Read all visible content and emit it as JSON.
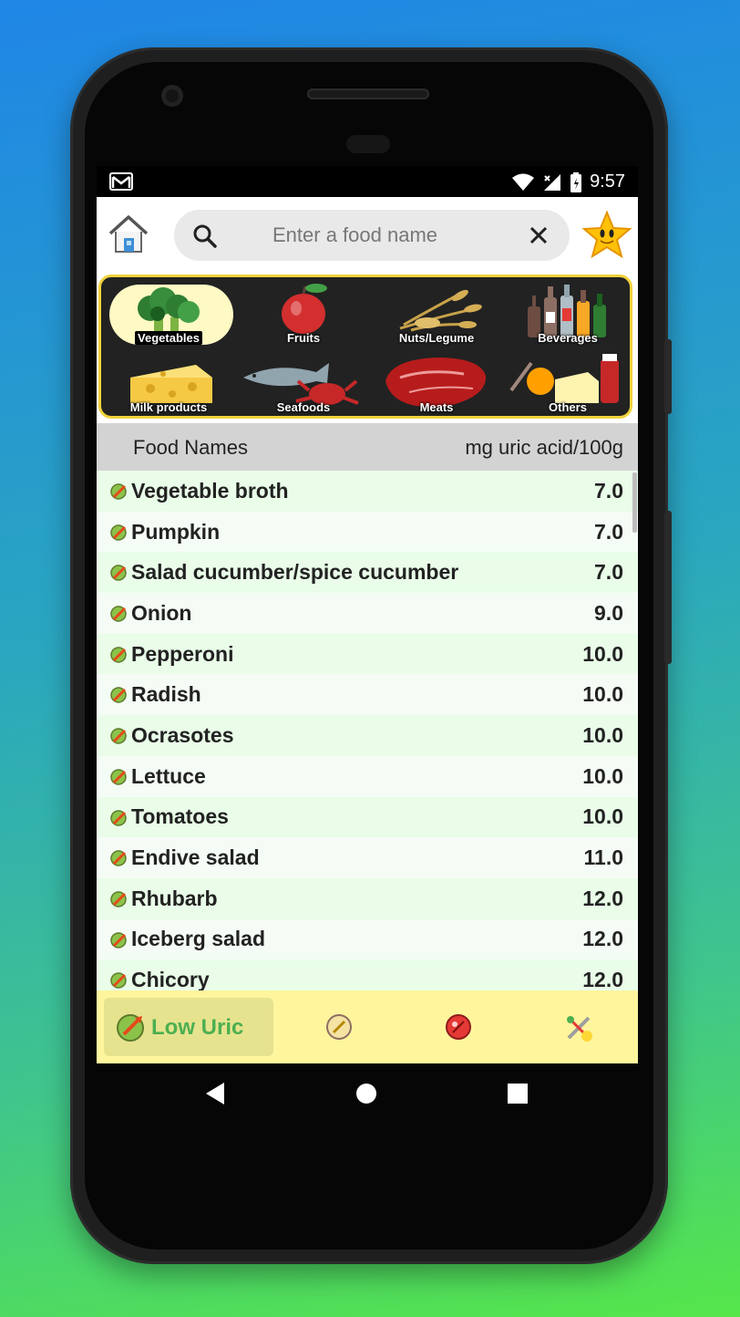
{
  "status": {
    "time": "9:57"
  },
  "search": {
    "placeholder": "Enter a food name"
  },
  "categories": [
    {
      "label": "Vegetables",
      "selected": true,
      "icon": "broccoli-icon"
    },
    {
      "label": "Fruits",
      "icon": "apple-icon"
    },
    {
      "label": "Nuts/Legume",
      "icon": "wheat-icon"
    },
    {
      "label": "Beverages",
      "icon": "bottles-icon"
    },
    {
      "label": "Milk products",
      "icon": "cheese-icon"
    },
    {
      "label": "Seafoods",
      "icon": "fish-crab-icon"
    },
    {
      "label": "Meats",
      "icon": "steak-icon"
    },
    {
      "label": "Others",
      "icon": "honey-jar-icon"
    }
  ],
  "table": {
    "col_name": "Food Names",
    "col_value": "mg uric acid/100g",
    "rows": [
      {
        "name": "Vegetable broth",
        "value": "7.0"
      },
      {
        "name": "Pumpkin",
        "value": "7.0"
      },
      {
        "name": "Salad cucumber/spice cucumber",
        "value": "7.0"
      },
      {
        "name": "Onion",
        "value": "9.0"
      },
      {
        "name": "Pepperoni",
        "value": "10.0"
      },
      {
        "name": "Radish",
        "value": "10.0"
      },
      {
        "name": "Ocrasotes",
        "value": "10.0"
      },
      {
        "name": "Lettuce",
        "value": "10.0"
      },
      {
        "name": "Tomatoes",
        "value": "10.0"
      },
      {
        "name": "Endive salad",
        "value": "11.0"
      },
      {
        "name": "Rhubarb",
        "value": "12.0"
      },
      {
        "name": "Iceberg salad",
        "value": "12.0"
      },
      {
        "name": "Chicory",
        "value": "12.0"
      }
    ]
  },
  "bottom_nav": {
    "active_label": "Low Uric"
  },
  "colors": {
    "accent_green": "#4caf50",
    "nav_bg": "#fff59d",
    "panel_border": "#f0d23c"
  }
}
